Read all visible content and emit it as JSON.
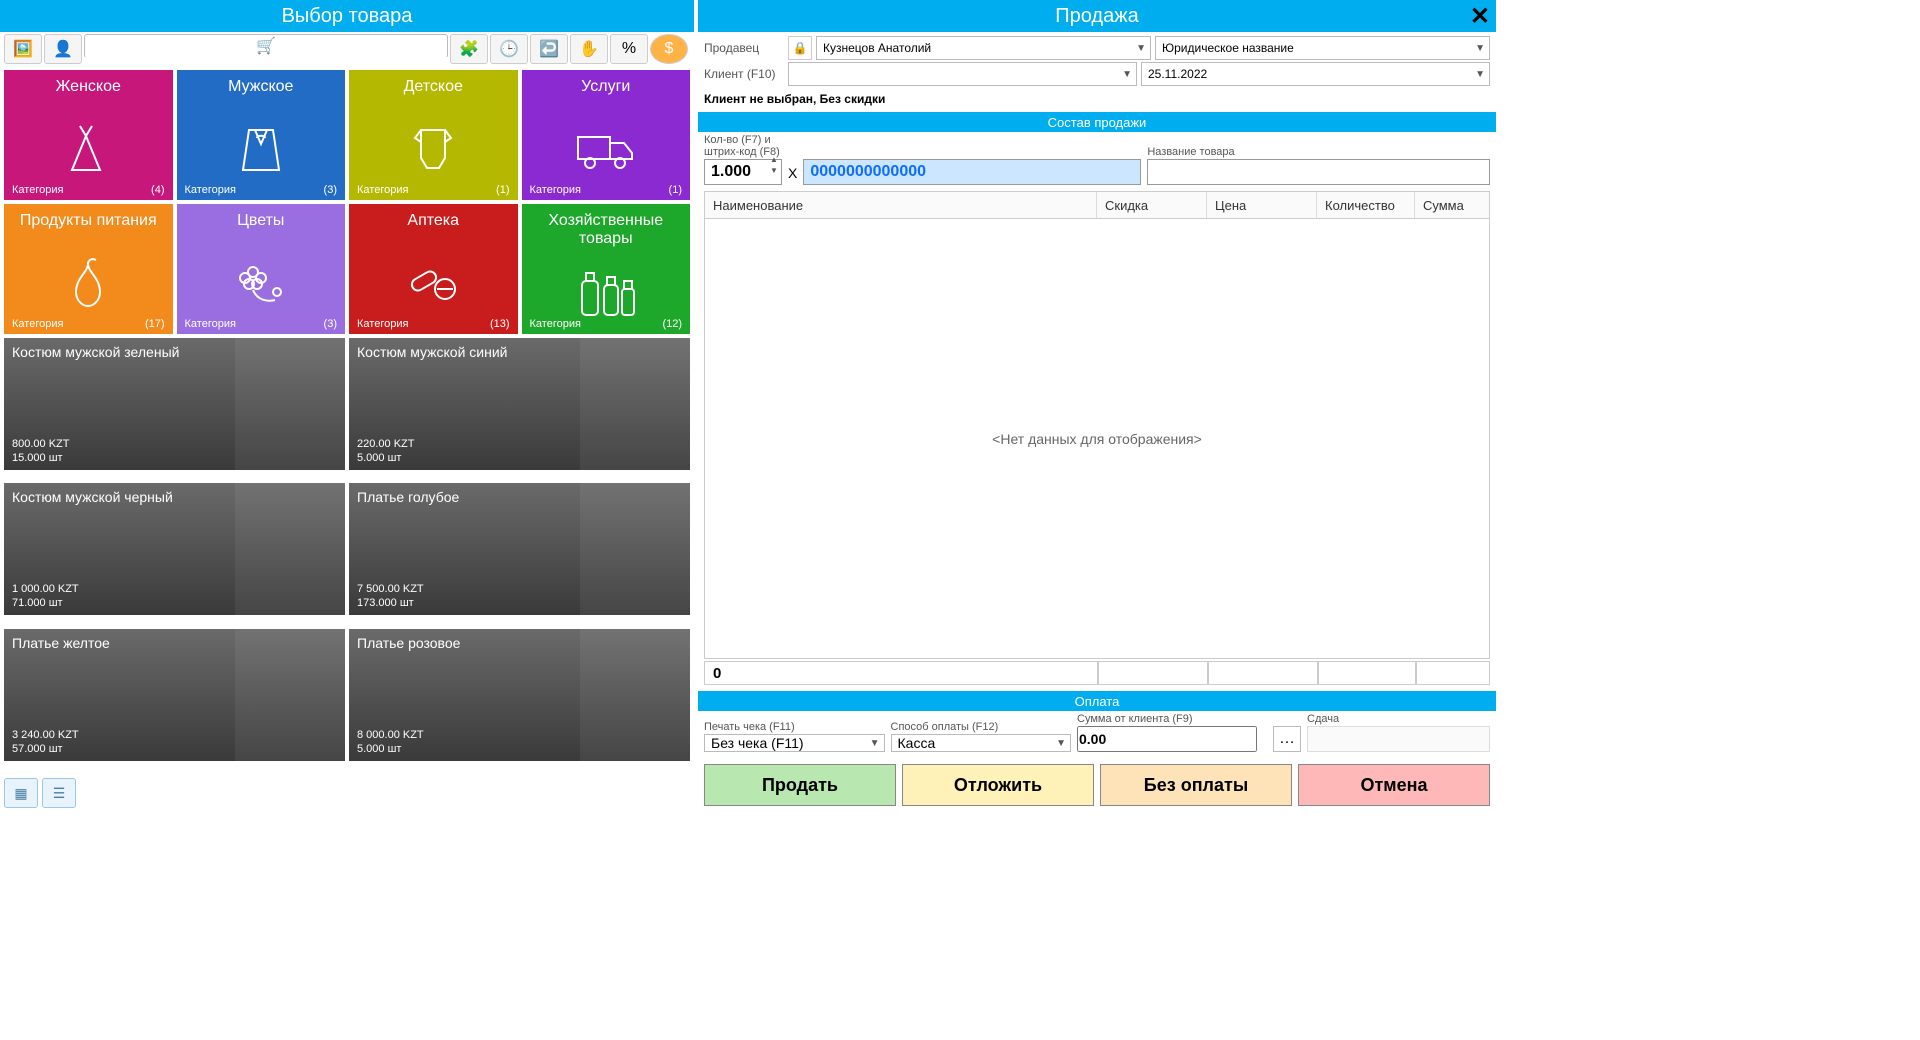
{
  "left": {
    "title": "Выбор товара",
    "toolbar_icons": [
      "picture",
      "person",
      "cart",
      "puzzle",
      "clock",
      "undo",
      "hand",
      "percent",
      "dollar"
    ],
    "categories": [
      {
        "title": "Женское",
        "count": "(4)",
        "bg": "#c8177b",
        "icon": "dress"
      },
      {
        "title": "Мужское",
        "count": "(3)",
        "bg": "#226cc6",
        "icon": "suit"
      },
      {
        "title": "Детское",
        "count": "(1)",
        "bg": "#b5b800",
        "icon": "romper"
      },
      {
        "title": "Услуги",
        "count": "(1)",
        "bg": "#8b2ad1",
        "icon": "truck"
      },
      {
        "title": "Продукты питания",
        "count": "(17)",
        "bg": "#f28a1c",
        "icon": "pear"
      },
      {
        "title": "Цветы",
        "count": "(3)",
        "bg": "#9a6de0",
        "icon": "flower"
      },
      {
        "title": "Аптека",
        "count": "(13)",
        "bg": "#c91d1d",
        "icon": "pills"
      },
      {
        "title": "Хозяйственные товары",
        "count": "(12)",
        "bg": "#1ea82b",
        "icon": "bottles"
      }
    ],
    "cat_label": "Категория",
    "products": [
      {
        "name": "Костюм мужской зеленый",
        "price": "800.00 KZT",
        "qty": "15.000 шт"
      },
      {
        "name": "Костюм мужской синий",
        "price": "220.00 KZT",
        "qty": "5.000 шт"
      },
      {
        "name": "Костюм мужской черный",
        "price": "1 000.00 KZT",
        "qty": "71.000 шт"
      },
      {
        "name": "Платье голубое",
        "price": "7 500.00 KZT",
        "qty": "173.000 шт"
      },
      {
        "name": "Платье желтое",
        "price": "3 240.00 KZT",
        "qty": "57.000 шт"
      },
      {
        "name": "Платье розовое",
        "price": "8 000.00 KZT",
        "qty": "5.000 шт"
      }
    ]
  },
  "right": {
    "title": "Продажа",
    "seller_lbl": "Продавец",
    "seller": "Кузнецов Анатолий",
    "entity": "Юридическое название",
    "client_lbl": "Клиент (F10)",
    "client": "",
    "date": "25.11.2022",
    "client_status": "Клиент не выбран, Без скидки",
    "section_sale": "Состав продажи",
    "qty_lbl": "Кол-во (F7) и штрих-код (F8)",
    "name_lbl": "Название товара",
    "qty_val": "1.000",
    "barcode_val": "0000000000000",
    "x": "X",
    "cols": {
      "name": "Наименование",
      "disc": "Скидка",
      "price": "Цена",
      "qty": "Количество",
      "sum": "Сумма"
    },
    "empty": "<Нет данных для отображения>",
    "total_name": "0",
    "section_pay": "Оплата",
    "print_lbl": "Печать чека (F11)",
    "print_val": "Без чека (F11)",
    "paymode_lbl": "Способ оплаты (F12)",
    "paymode_val": "Касса",
    "amount_lbl": "Сумма от клиента (F9)",
    "amount_val": "0.00",
    "change_lbl": "Сдача",
    "change_val": "",
    "btn_sell": "Продать",
    "btn_hold": "Отложить",
    "btn_nopay": "Без оплаты",
    "btn_cancel": "Отмена"
  }
}
